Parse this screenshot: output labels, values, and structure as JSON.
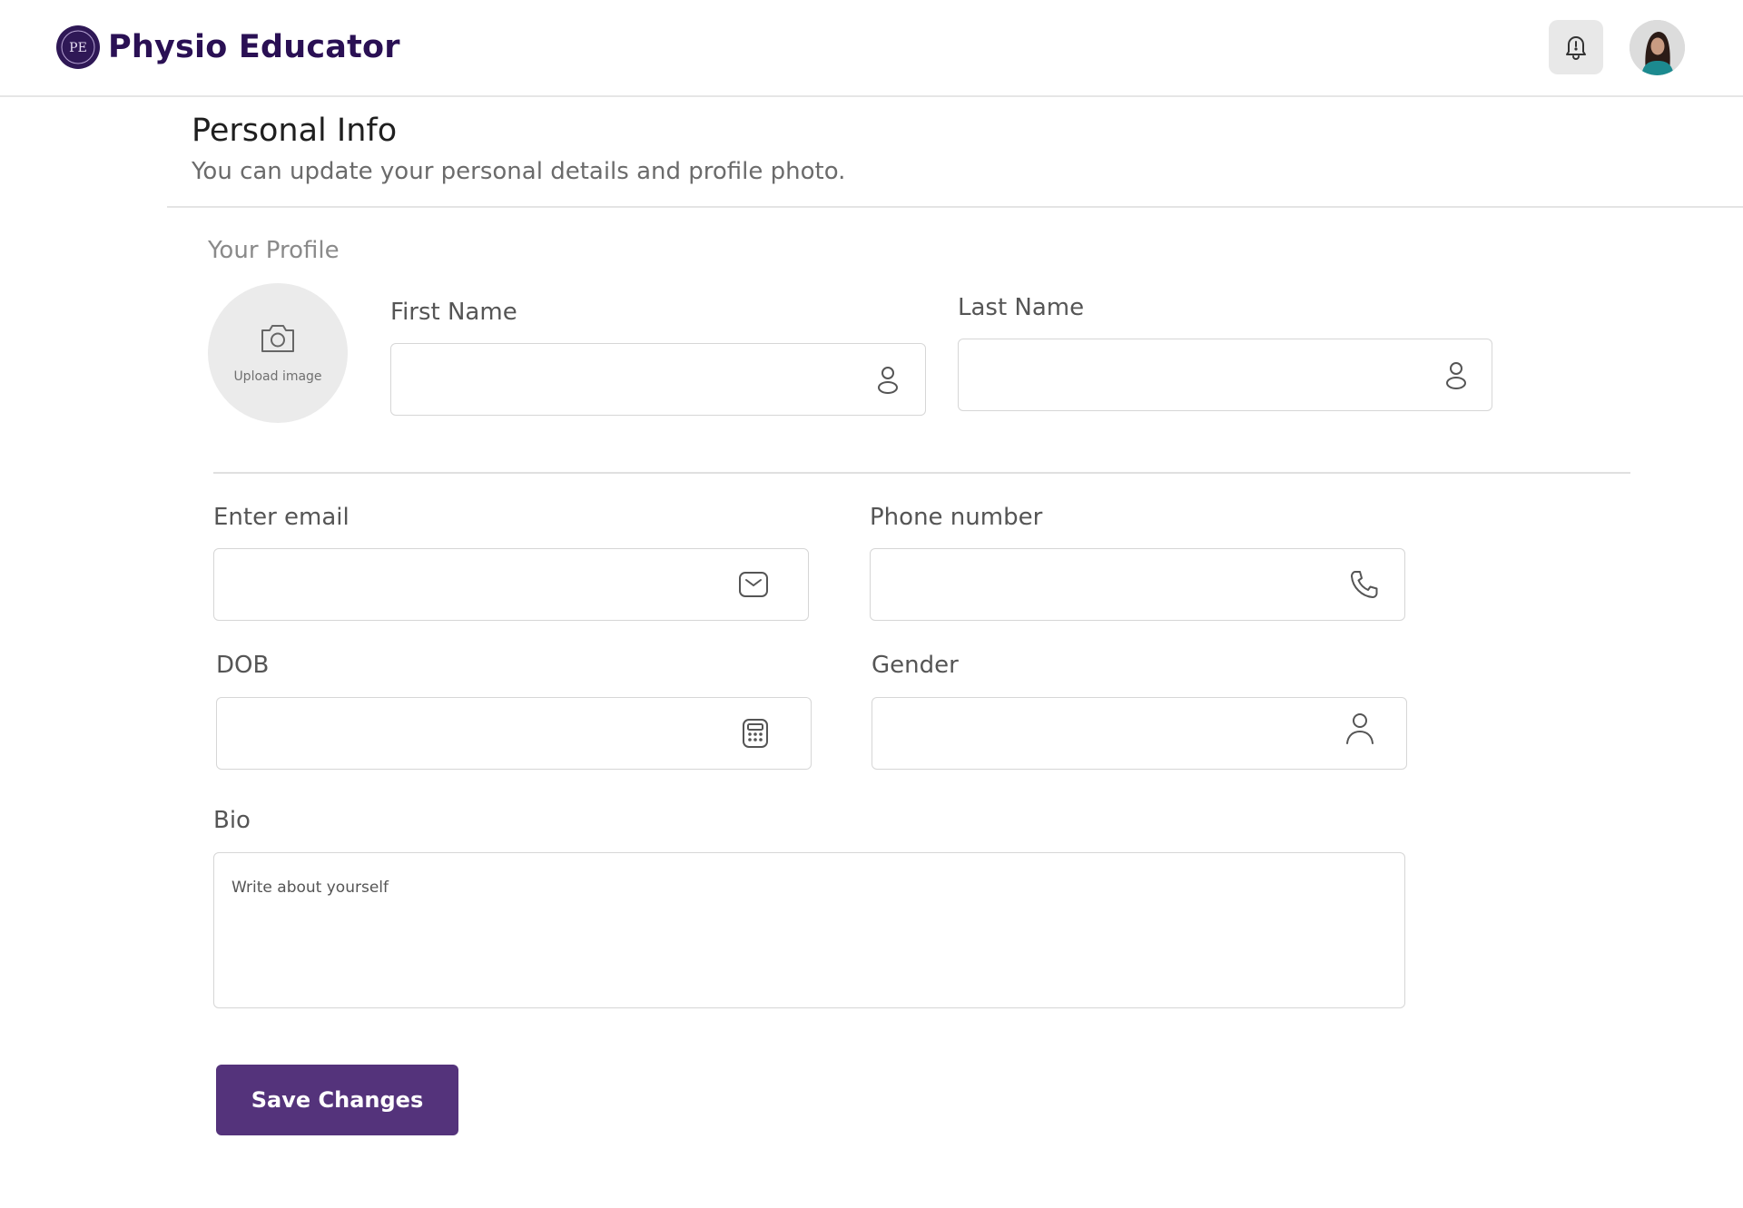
{
  "header": {
    "brand_name": "Physio Educator",
    "logo_text": "PE",
    "icons": {
      "logo": "pe-logo-icon",
      "notifications": "bell-icon",
      "avatar": "user-avatar"
    }
  },
  "page": {
    "title": "Personal Info",
    "subtitle": "You can update your personal details and profile photo."
  },
  "profile": {
    "section_label": "Your Profile",
    "upload_label": "Upload image"
  },
  "form": {
    "first_name": {
      "label": "First Name",
      "value": "",
      "placeholder": "",
      "icon": "user-icon"
    },
    "last_name": {
      "label": "Last Name",
      "value": "",
      "placeholder": "",
      "icon": "user-icon"
    },
    "email": {
      "label": "Enter email",
      "value": "",
      "placeholder": "",
      "icon": "mail-icon"
    },
    "phone": {
      "label": "Phone number",
      "value": "",
      "placeholder": "",
      "icon": "phone-icon"
    },
    "dob": {
      "label": "DOB",
      "value": "",
      "placeholder": "",
      "icon": "calendar-icon"
    },
    "gender": {
      "label": "Gender",
      "value": "",
      "placeholder": "",
      "icon": "user-icon"
    },
    "bio": {
      "label": "Bio",
      "value": "",
      "placeholder": "Write about yourself"
    }
  },
  "actions": {
    "save_label": "Save Changes"
  },
  "colors": {
    "brand": "#2a1054",
    "primary_button": "#54337b",
    "border": "#d6d6d6",
    "upload_bg": "#ebebeb"
  }
}
